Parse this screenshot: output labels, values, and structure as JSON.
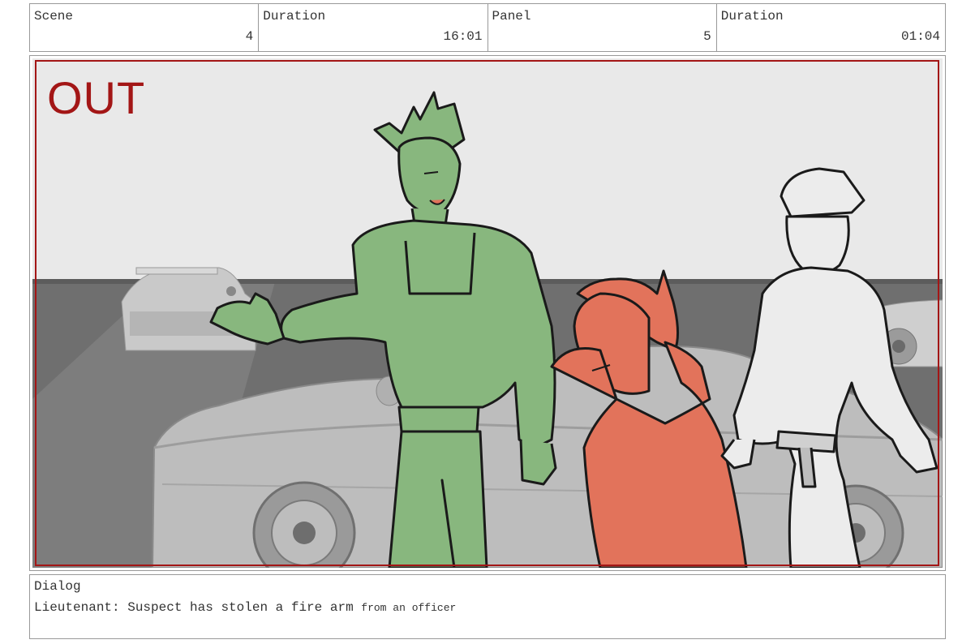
{
  "header": {
    "scene_label": "Scene",
    "scene_value": "4",
    "duration_label": "Duration",
    "duration_value": "16:01",
    "panel_label": "Panel",
    "panel_value": "5",
    "panel_duration_label": "Duration",
    "panel_duration_value": "01:04"
  },
  "frame": {
    "marker_text": "OUT",
    "marker_color": "#a31616"
  },
  "dialog": {
    "label": "Dialog",
    "line_main": "Lieutenant: Suspect has stolen a fire arm",
    "line_tail": "from an officer"
  },
  "colors": {
    "green_character": "#88b77e",
    "red_character": "#e2735b",
    "frame_border": "#a31616"
  }
}
